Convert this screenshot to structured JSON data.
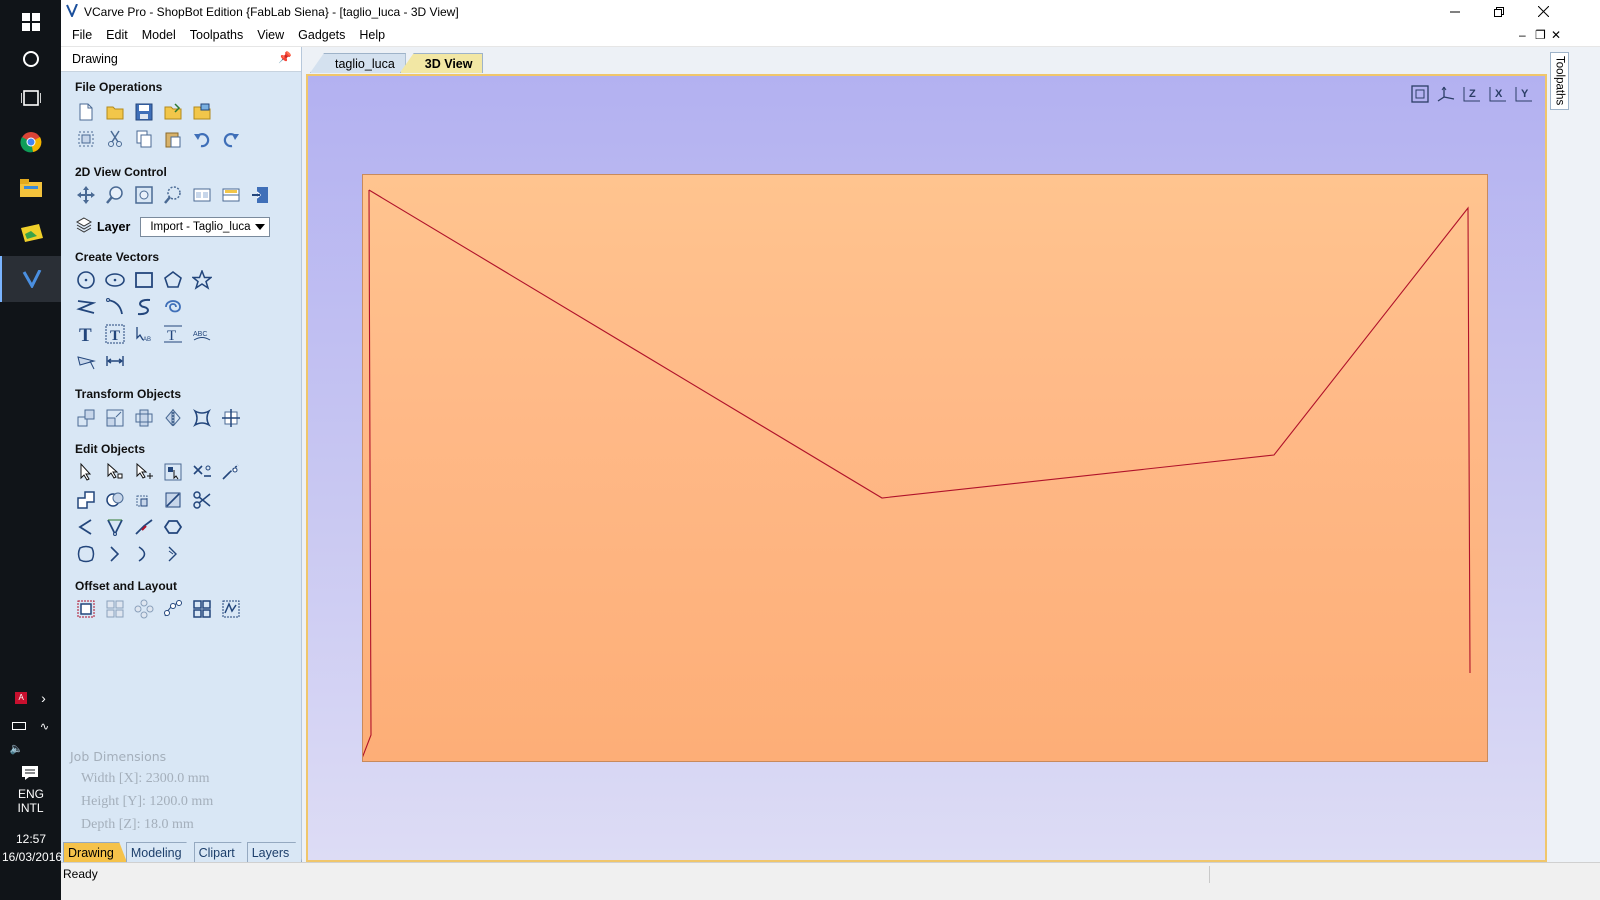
{
  "window": {
    "title": "VCarve Pro - ShopBot Edition {FabLab Siena} - [taglio_luca - 3D View]"
  },
  "menu": [
    "File",
    "Edit",
    "Model",
    "Toolpaths",
    "View",
    "Gadgets",
    "Help"
  ],
  "panel": {
    "header": "Drawing",
    "sections": {
      "file_operations": "File Operations",
      "view_control": "2D View Control",
      "create_vectors": "Create Vectors",
      "transform_objects": "Transform Objects",
      "edit_objects": "Edit Objects",
      "offset_layout": "Offset and Layout"
    },
    "layer": {
      "label": "Layer",
      "value": "Import - Taglio_luca"
    },
    "job_dimensions": {
      "title": "Job Dimensions",
      "width": "Width  [X]: 2300.0 mm",
      "height": "Height [Y]: 1200.0 mm",
      "depth": "Depth  [Z]: 18.0 mm"
    },
    "bottom_tabs": [
      "Drawing",
      "Modeling",
      "Clipart",
      "Layers"
    ]
  },
  "doc_tabs": [
    "taglio_luca",
    "3D View"
  ],
  "right_tab": "Toolpaths",
  "status": "Ready",
  "taskbar": {
    "lang1": "ENG",
    "lang2": "INTL",
    "time": "12:57",
    "date": "16/03/2016"
  },
  "colors": {
    "panel_bg": "#d9e7f5",
    "active_tab": "#f5c24a",
    "view_border": "#f0c66b",
    "vector_line": "#b0122a"
  }
}
